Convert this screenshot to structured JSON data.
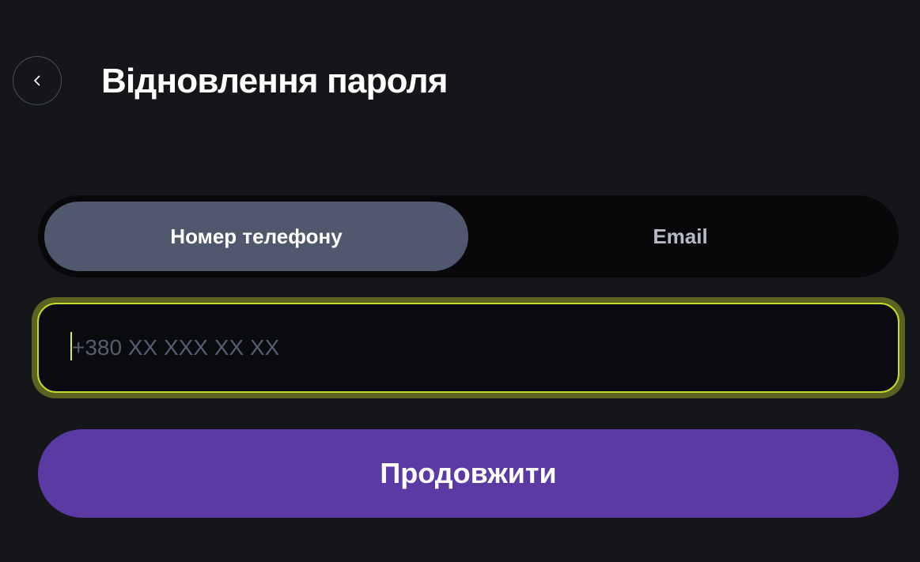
{
  "header": {
    "title": "Відновлення пароля",
    "back_icon": "chevron-left-icon"
  },
  "method_tabs": {
    "selected": "phone",
    "phone_label": "Номер телефону",
    "email_label": "Email"
  },
  "phone_input": {
    "value": "",
    "placeholder": "+380 XX XXX XX XX"
  },
  "continue_button": {
    "label": "Продовжити"
  },
  "colors": {
    "background": "#15161a",
    "tab_track": "#08080a",
    "tab_selected": "#4f586d",
    "focus_ring": "#c5da2a",
    "primary_button": "#5b3aa4"
  }
}
